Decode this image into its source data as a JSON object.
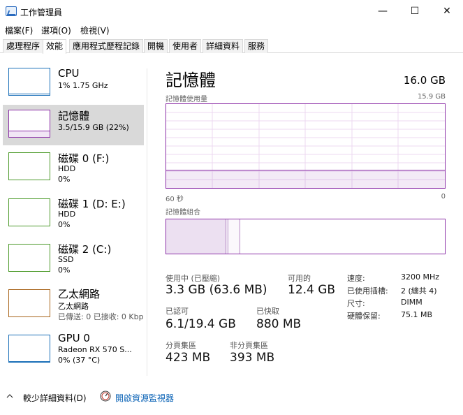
{
  "window": {
    "title": "工作管理員",
    "controls": {
      "minimize": "—",
      "maximize": "☐",
      "close": "✕"
    }
  },
  "menu": [
    "檔案(F)",
    "選項(O)",
    "檢視(V)"
  ],
  "tabs": [
    "處理程序",
    "效能",
    "應用程式歷程記錄",
    "開機",
    "使用者",
    "詳細資料",
    "服務"
  ],
  "sidebar": [
    {
      "title": "CPU",
      "lines": [
        "1% 1.75 GHz"
      ],
      "color": "#1a6fb8"
    },
    {
      "title": "記憶體",
      "lines": [
        "3.5/15.9 GB (22%)"
      ],
      "color": "#8b2fa7"
    },
    {
      "title": "磁碟 0 (F:)",
      "lines": [
        "HDD",
        "0%"
      ],
      "color": "#4c9a2a"
    },
    {
      "title": "磁碟 1 (D: E:)",
      "lines": [
        "HDD",
        "0%"
      ],
      "color": "#4c9a2a"
    },
    {
      "title": "磁碟 2 (C:)",
      "lines": [
        "SSD",
        "0%"
      ],
      "color": "#4c9a2a"
    },
    {
      "title": "乙太網路",
      "lines": [
        "乙太網路",
        "已傳送: 0 已接收: 0 Kbp"
      ],
      "color": "#a8641a"
    },
    {
      "title": "GPU 0",
      "lines": [
        "Radeon RX 570 S...",
        "0% (37 °C)"
      ],
      "color": "#1a6fb8"
    }
  ],
  "main": {
    "title": "記憶體",
    "total": "16.0 GB",
    "usage_label": "記憶體使用量",
    "usage_max": "15.9 GB",
    "usage_fraction": 0.22,
    "time_left": "60 秒",
    "time_right": "0",
    "composition_label": "記憶體組合",
    "stats": {
      "in_use_label": "使用中 (已壓縮)",
      "in_use_value": "3.3 GB (63.6 MB)",
      "available_label": "可用的",
      "available_value": "12.4 GB",
      "committed_label": "已認可",
      "committed_value": "6.1/19.4 GB",
      "cached_label": "已快取",
      "cached_value": "880 MB",
      "paged_label": "分頁集區",
      "paged_value": "423 MB",
      "nonpaged_label": "非分頁集區",
      "nonpaged_value": "393 MB"
    },
    "details": [
      {
        "label": "速度:",
        "value": "3200 MHz"
      },
      {
        "label": "已使用插槽:",
        "value": "2 (總共 4)"
      },
      {
        "label": "尺寸:",
        "value": "DIMM"
      },
      {
        "label": "硬體保留:",
        "value": "75.1 MB"
      }
    ]
  },
  "footer": {
    "fewer_details": "較少詳細資料(D)",
    "resource_monitor": "開啟資源監視器"
  },
  "colors": {
    "memory": "#8b2fa7",
    "cpu": "#1a6fb8",
    "disk": "#4c9a2a",
    "ethernet": "#a8641a",
    "link": "#0b63b6"
  }
}
